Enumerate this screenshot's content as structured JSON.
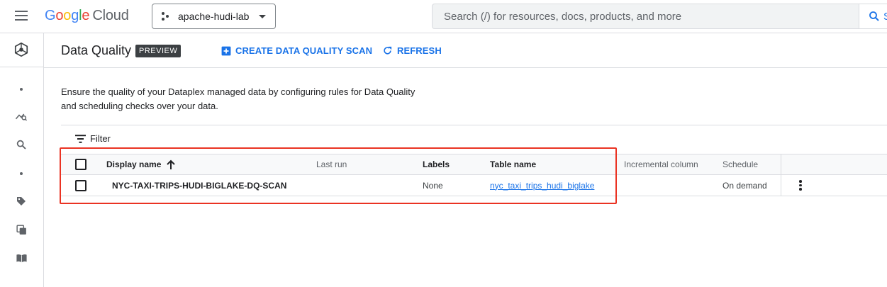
{
  "topbar": {
    "logo_google": [
      "G",
      "o",
      "o",
      "g",
      "l",
      "e"
    ],
    "logo_product": "Cloud",
    "project_name": "apache-hudi-lab",
    "search_placeholder": "Search (/) for resources, docs, products, and more",
    "search_button_label": "S"
  },
  "rail": {
    "icons": [
      "dataplex-icon",
      "dot-icon",
      "explore-icon",
      "search-icon",
      "dot-icon",
      "tag-icon",
      "manage-icon",
      "book-icon"
    ]
  },
  "header": {
    "title": "Data Quality",
    "badge": "PREVIEW",
    "create_label": "CREATE DATA QUALITY SCAN",
    "refresh_label": "REFRESH"
  },
  "description": {
    "line1": "Ensure the quality of your Dataplex managed data by configuring rules for Data Quality",
    "line2": "and scheduling checks over your data."
  },
  "filter_label": "Filter",
  "table": {
    "columns": {
      "display_name": "Display name",
      "last_run": "Last run",
      "labels": "Labels",
      "table_name": "Table name",
      "incremental_column": "Incremental column",
      "schedule": "Schedule"
    },
    "rows": [
      {
        "display_name": "NYC-TAXI-TRIPS-HUDI-BIGLAKE-DQ-SCAN",
        "last_run": "",
        "labels": "None",
        "table_name": "nyc_taxi_trips_hudi_biglake",
        "incremental_column": "",
        "schedule": "On demand"
      }
    ]
  },
  "colors": {
    "accent": "#1a73e8",
    "highlight": "#ea3323",
    "badge_bg": "#3c4043"
  }
}
